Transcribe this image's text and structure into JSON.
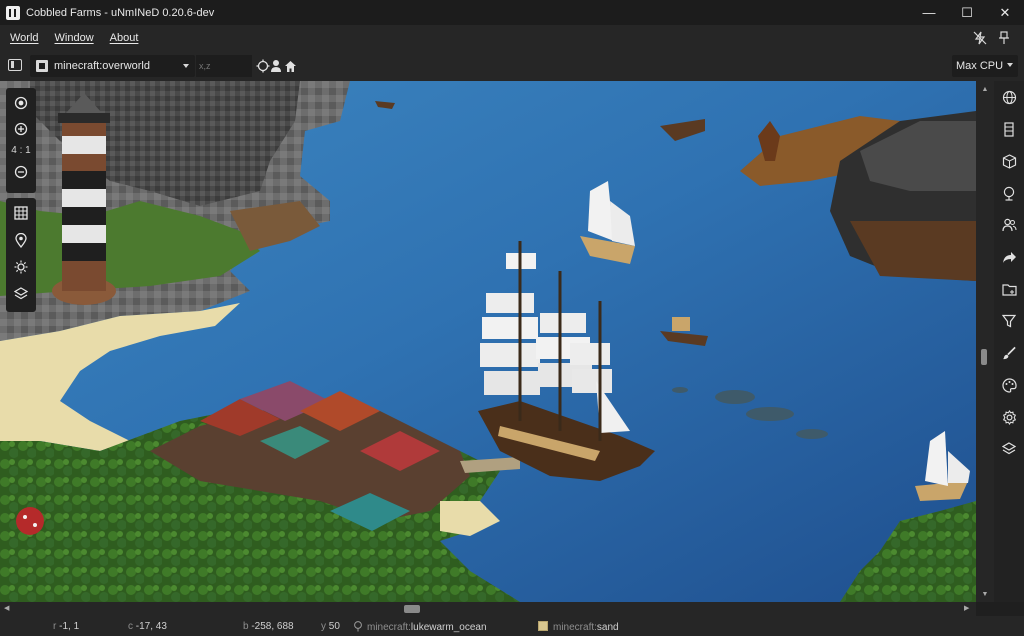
{
  "window": {
    "title": "Cobbled Farms - uNmINeD 0.20.6-dev",
    "controls": {
      "minimize": "—",
      "maximize": "☐",
      "close": "✕"
    }
  },
  "menu": {
    "items": [
      "World",
      "Window",
      "About"
    ],
    "right_icons": [
      "lightning-off-icon",
      "pin-icon"
    ]
  },
  "toolbar": {
    "world": "minecraft:overworld",
    "coord_placeholder": "x,z",
    "icons": [
      "crosshair-icon",
      "player-icon",
      "home-icon"
    ],
    "performance": "Max CPU"
  },
  "map_controls": {
    "zoom_label": "4 : 1",
    "icons": [
      "center-icon",
      "zoom-in-icon",
      "zoom-out-icon",
      "grid-icon",
      "marker-icon",
      "sun-icon",
      "layers-icon"
    ]
  },
  "right_panel": {
    "icons": [
      "globe-icon",
      "block-column-icon",
      "cube-icon",
      "tree-icon",
      "players-icon",
      "share-icon",
      "folder-icon",
      "filter-icon",
      "brush-icon",
      "palette-icon",
      "settings-icon",
      "layers-icon"
    ]
  },
  "status": {
    "region_label": "r",
    "region": "-1, 1",
    "chunk_label": "c",
    "chunk": "-17, 43",
    "block_label": "b",
    "block": "-258, 688",
    "y_label": "y",
    "y": "50",
    "biome_ns": "minecraft:",
    "biome": "lukewarm_ocean",
    "block_ns": "minecraft:",
    "block_type": "sand"
  },
  "colors": {
    "ocean": "#2f6fae",
    "deep_ocean": "#1f4e8a",
    "sand": "#e8dcaa",
    "grass": "#4f7a2d",
    "stone": "#6b6b6b",
    "chrome": "#262626"
  }
}
